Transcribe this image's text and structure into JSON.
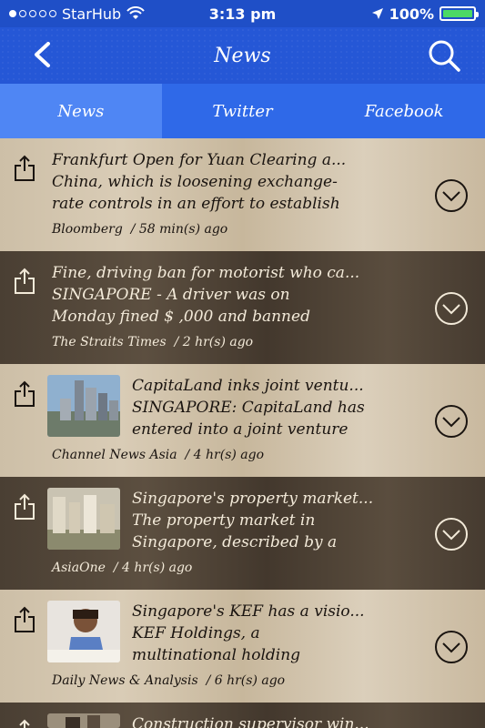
{
  "status_bar": {
    "carrier": "StarHub",
    "time": "3:13 pm",
    "battery": "100%",
    "battery_level": 1.0
  },
  "nav": {
    "title": "News",
    "back_icon": "chevron-left-icon",
    "search_icon": "search-icon"
  },
  "tabs": [
    {
      "label": "News",
      "active": true
    },
    {
      "label": "Twitter",
      "active": false
    },
    {
      "label": "Facebook",
      "active": false
    }
  ],
  "feed": [
    {
      "title": "Frankfurt Open for Yuan Clearing a...",
      "line1": "China, which is loosening exchange-",
      "line2": "rate controls in an effort to establish",
      "source": "Bloomberg",
      "age": "/ 58 min(s) ago"
    },
    {
      "title": "Fine, driving ban for motorist who ca...",
      "line1": "SINGAPORE - A driver was on",
      "line2": "Monday fined $ ,000 and banned",
      "source": "The Straits Times",
      "age": "/ 2 hr(s) ago"
    },
    {
      "title": "CapitaLand inks joint ventu...",
      "line1": "SINGAPORE: CapitaLand has",
      "line2": "entered into a joint venture",
      "source": "Channel News Asia",
      "age": "/ 4 hr(s) ago"
    },
    {
      "title": "Singapore's property market...",
      "line1": "The property market in",
      "line2": "Singapore, described by a",
      "source": "AsiaOne",
      "age": "/ 4 hr(s) ago"
    },
    {
      "title": "Singapore's KEF has a visio...",
      "line1": "KEF Holdings, a",
      "line2": "multinational holding",
      "source": "Daily News & Analysis",
      "age": "/ 6 hr(s) ago"
    },
    {
      "title": "Construction supervisor win..."
    }
  ],
  "colors": {
    "nav_blue": "#2557d6",
    "tab_blue": "#2f69e8",
    "tab_active": "#4f86f4"
  }
}
